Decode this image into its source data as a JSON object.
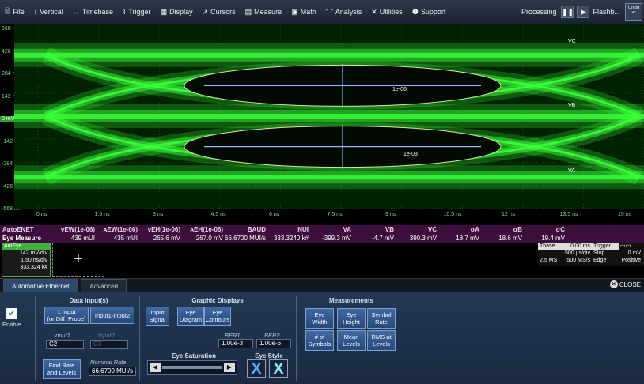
{
  "menubar": {
    "items": [
      {
        "icon": "file-icon",
        "glyph": "🗎",
        "label": "File"
      },
      {
        "icon": "vertical-icon",
        "glyph": "↕",
        "label": "Vertical"
      },
      {
        "icon": "timebase-icon",
        "glyph": "↔",
        "label": "Timebase"
      },
      {
        "icon": "trigger-icon",
        "glyph": "⌇",
        "label": "Trigger"
      },
      {
        "icon": "display-icon",
        "glyph": "▦",
        "label": "Display"
      },
      {
        "icon": "cursors-icon",
        "glyph": "↗",
        "label": "Cursors"
      },
      {
        "icon": "measure-icon",
        "glyph": "▤",
        "label": "Measure"
      },
      {
        "icon": "math-icon",
        "glyph": "▣",
        "label": "Math"
      },
      {
        "icon": "analysis-icon",
        "glyph": "⌒",
        "label": "Analysis"
      },
      {
        "icon": "utilities-icon",
        "glyph": "✕",
        "label": "Utilities"
      },
      {
        "icon": "support-icon",
        "glyph": "❶",
        "label": "Support"
      }
    ],
    "processing": "Processing",
    "flashback": "Flashb...",
    "undo": "Undo"
  },
  "grid": {
    "y_labels": [
      "568 mV",
      "426 mV",
      "284 mV",
      "142 mV",
      "0 mV",
      "-142 mV",
      "-284 mV",
      "-426 mV",
      "-568 mV"
    ],
    "x_labels": [
      "0 ns",
      "1.5 ns",
      "3 ns",
      "4.5 ns",
      "6 ns",
      "7.5 ns",
      "9 ns",
      "10.5 ns",
      "12 ns",
      "13.5 ns",
      "15 ns"
    ],
    "eye_labels": {
      "vc": "VC",
      "vb": "VB",
      "va": "VA",
      "ber_upper": "1e-06",
      "ber_lower": "1e-03"
    },
    "trace_color": "#39ff39"
  },
  "measure_table": {
    "row_title": "AutoENET",
    "row_sub": "Eye Measure",
    "headers": [
      "vEW(1e-06)",
      "ᴀEW(1e-06)",
      "vEH(1e-06)",
      "ᴀEH(1e-06)",
      "BAUD",
      "NUI",
      "VA",
      "VB",
      "VC",
      "σA",
      "σB",
      "σC"
    ],
    "values": [
      "439 mUI",
      "435 mUI",
      "265.6 mV",
      "267.0 mV",
      "66.6700 MUI/s",
      "333.3240 k#",
      "-399.3 mV",
      "-4.7 mV",
      "390.3 mV",
      "18.7 mV",
      "18.6 mV",
      "19.4 mV"
    ]
  },
  "trace_descriptor": {
    "name": "AutEye",
    "vdiv": "142 mV/div",
    "tdiv": "1.50 ns/div",
    "count": "333.324 k#"
  },
  "timebase": {
    "tbase_label": "Tbase",
    "tbase_value": "0.00 ms",
    "trigger_label": "Trigger",
    "tdiv": "500 µs/div",
    "stop": "Stop",
    "trig_level": "0 mV",
    "samples": "2.5 MS",
    "rate": "500 MS/s",
    "edge": "Edge",
    "slope": "Positive"
  },
  "tabs": [
    "Automotive Ethernet",
    "Advanced"
  ],
  "close_label": "CLOSE",
  "panel": {
    "enable_label": "Enable",
    "data_inputs_title": "Data Input(s)",
    "btn_1input": "1 Input\n(or Diff. Probe)",
    "btn_input1input2": "Input1-Input2",
    "input1_label": "Input1",
    "input1_value": "C2",
    "input2_label": "Input2",
    "input2_value": "C3",
    "find_rate_btn": "Find Rate\nand Levels",
    "nominal_rate_label": "Nominal Rate",
    "nominal_rate_value": "66.6700 MUI/s",
    "graphic_title": "Graphic Displays",
    "btn_input_signal": "Input\nSignal",
    "btn_eye_diagram": "Eye\nDiagram",
    "btn_eye_contours": "Eye\nContours",
    "ber1_label": "BER1",
    "ber1_value": "1.00e-3",
    "ber2_label": "BER2",
    "ber2_value": "1.00e-6",
    "eye_saturation_label": "Eye Saturation",
    "eye_style_label": "Eye Style",
    "measurements_title": "Measurements",
    "btn_eye_width": "Eye\nWidth",
    "btn_eye_height": "Eye\nHeight",
    "btn_symbol_rate": "Symbol\nRate",
    "btn_num_symbols": "# of\nSymbols",
    "btn_mean_levels": "Mean\nLevels",
    "btn_rms_levels": "RMS at\nLevels"
  }
}
